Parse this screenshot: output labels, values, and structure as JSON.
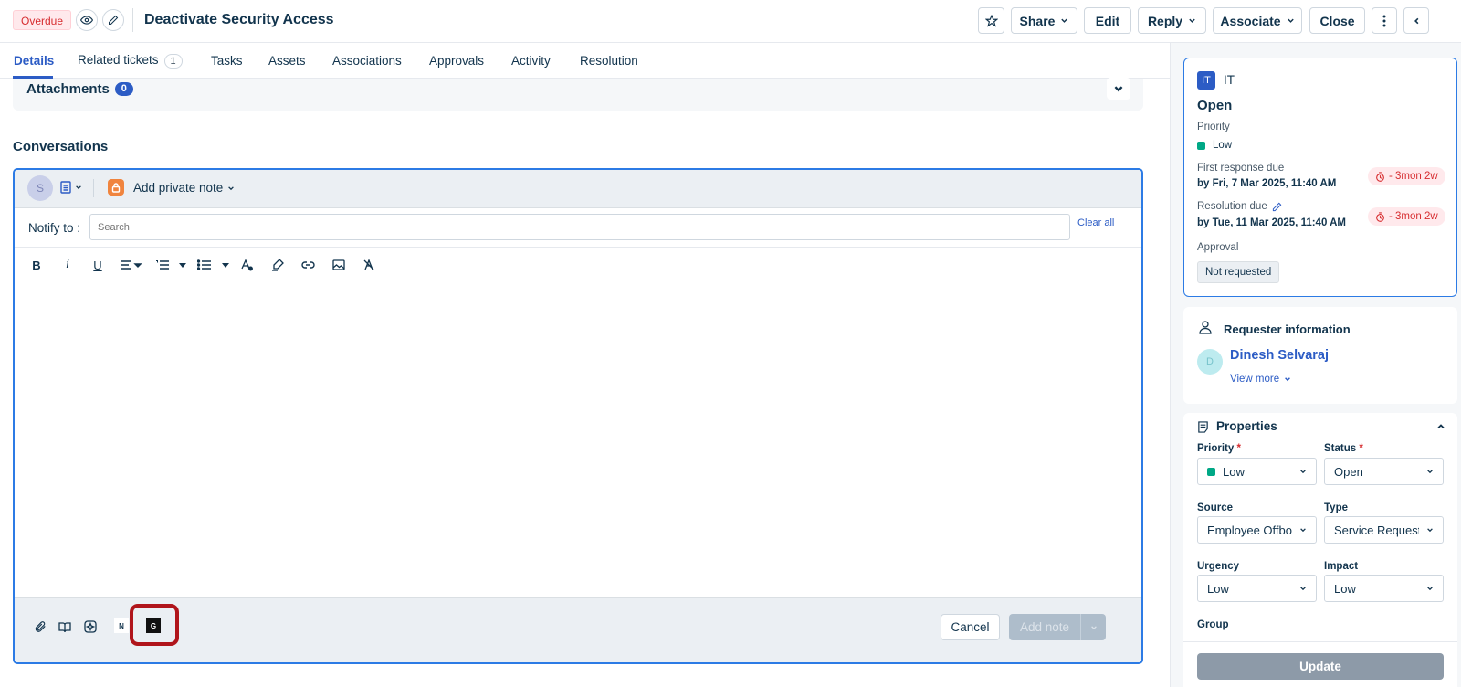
{
  "header": {
    "status_badge": "Overdue",
    "title": "Deactivate Security Access",
    "buttons": {
      "share": "Share",
      "edit": "Edit",
      "reply": "Reply",
      "associate": "Associate",
      "close": "Close"
    }
  },
  "tabs": [
    {
      "label": "Details",
      "active": true
    },
    {
      "label": "Related tickets",
      "count": "1"
    },
    {
      "label": "Tasks"
    },
    {
      "label": "Assets"
    },
    {
      "label": "Associations"
    },
    {
      "label": "Approvals"
    },
    {
      "label": "Activity"
    },
    {
      "label": "Resolution"
    }
  ],
  "attachments": {
    "label": "Attachments",
    "count": "0"
  },
  "conversations": {
    "title": "Conversations",
    "avatar_initial": "S",
    "note_type": "Add private note",
    "notify_label": "Notify to :",
    "notify_placeholder": "Search",
    "clear_all": "Clear all",
    "footer": {
      "n_label": "N",
      "g_label": "G",
      "cancel": "Cancel",
      "add_note": "Add note"
    }
  },
  "ticket_summary": {
    "group_badge": "IT",
    "group_name": "IT",
    "status": "Open",
    "priority_label": "Priority",
    "priority_value": "Low",
    "first_response_label": "First response due",
    "first_response_value": "by Fri, 7 Mar 2025, 11:40 AM",
    "first_response_sla": "- 3mon 2w",
    "resolution_label": "Resolution due",
    "resolution_value": "by Tue, 11 Mar 2025, 11:40 AM",
    "resolution_sla": "- 3mon 2w",
    "approval_label": "Approval",
    "approval_value": "Not requested"
  },
  "requester": {
    "title": "Requester information",
    "avatar_initial": "D",
    "name": "Dinesh Selvaraj",
    "view_more": "View more"
  },
  "properties": {
    "title": "Properties",
    "priority_label": "Priority",
    "priority_value": "Low",
    "status_label": "Status",
    "status_value": "Open",
    "source_label": "Source",
    "source_value": "Employee Offbo",
    "type_label": "Type",
    "type_value": "Service Request",
    "urgency_label": "Urgency",
    "urgency_value": "Low",
    "impact_label": "Impact",
    "impact_value": "Low",
    "group_label": "Group",
    "update_button": "Update"
  },
  "colors": {
    "accent": "#2c5cc5",
    "overdue": "#d72d30",
    "highlight": "#b0151b",
    "priority_low": "#00a886"
  }
}
